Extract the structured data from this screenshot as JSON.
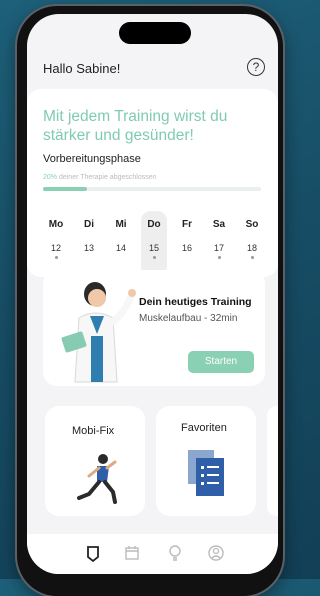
{
  "greeting": "Hallo Sabine!",
  "help_icon_text": "?",
  "motivation_text": "Mit jedem Training wirst du stärker und gesünder!",
  "phase_title": "Vorbereitungsphase",
  "progress": {
    "percent_label": "20%",
    "suffix": " deiner Therapie abgeschlossen",
    "value": 0.2
  },
  "week": {
    "days": [
      {
        "name": "Mo",
        "date": "12"
      },
      {
        "name": "Di",
        "date": "13"
      },
      {
        "name": "Mi",
        "date": "14"
      },
      {
        "name": "Do",
        "date": "15"
      },
      {
        "name": "Fr",
        "date": "16"
      },
      {
        "name": "Sa",
        "date": "17"
      },
      {
        "name": "So",
        "date": "18"
      }
    ],
    "selected": "Do"
  },
  "training": {
    "title": "Dein heutiges Training",
    "subtitle": "Muskelaufbau - 32min",
    "start_label": "Starten"
  },
  "tiles": {
    "mobifix": "Mobi-Fix",
    "favorites": "Favoriten"
  },
  "colors": {
    "accent": "#8ad0b5",
    "motto": "#7fcbb2",
    "background": "#174e66"
  },
  "tabbar_icons": [
    "shield-icon",
    "calendar-icon",
    "bulb-icon",
    "profile-icon"
  ]
}
